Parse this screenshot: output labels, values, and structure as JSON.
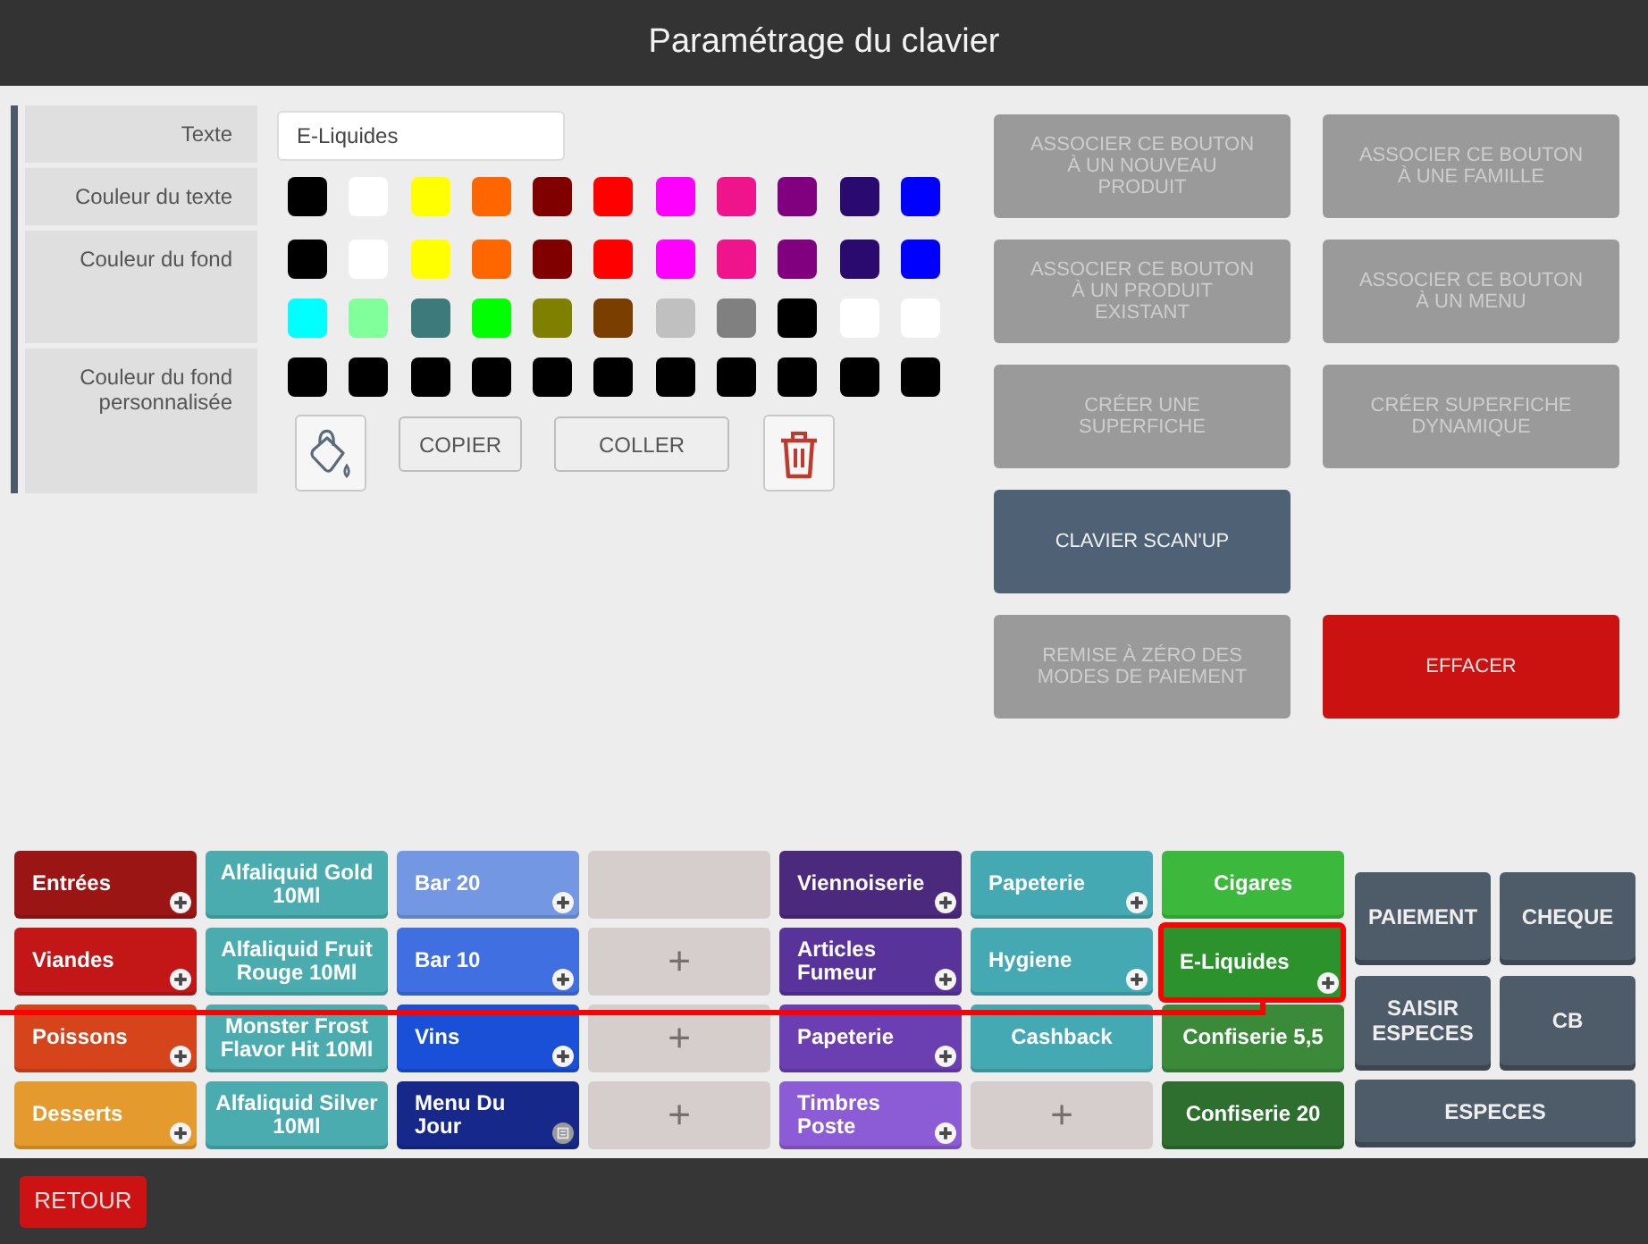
{
  "window": {
    "title": "Paramétrage du clavier"
  },
  "editor": {
    "text_field": {
      "label": "Texte",
      "value": "E-Liquides"
    },
    "text_color": {
      "label": "Couleur du texte",
      "swatches": [
        {
          "color": "#000000"
        },
        {
          "color": "#ffffff"
        },
        {
          "color": "#ffff00"
        },
        {
          "color": "#ff6600"
        },
        {
          "color": "#800000"
        },
        {
          "color": "#ff0000"
        },
        {
          "color": "#ff00ff"
        },
        {
          "color": "#f0148c"
        },
        {
          "color": "#800080"
        },
        {
          "color": "#2a0a6e"
        },
        {
          "color": "#0000ff"
        }
      ]
    },
    "background_color": {
      "label": "Couleur du fond",
      "swatches": [
        {
          "color": "#000000"
        },
        {
          "color": "#ffffff"
        },
        {
          "color": "#ffff00"
        },
        {
          "color": "#ff6600"
        },
        {
          "color": "#800000"
        },
        {
          "color": "#ff0000"
        },
        {
          "color": "#ff00ff"
        },
        {
          "color": "#f0148c"
        },
        {
          "color": "#800080"
        },
        {
          "color": "#2a0a6e"
        },
        {
          "color": "#0000ff"
        },
        {
          "color": "#00ffff"
        },
        {
          "color": "#80ff9a"
        },
        {
          "color": "#3d7a7a"
        },
        {
          "color": "#00ff00"
        },
        {
          "color": "#808000"
        },
        {
          "color": "#7a3e00"
        },
        {
          "color": "#c0c0c0"
        },
        {
          "color": "#808080"
        },
        {
          "color": "#000000"
        },
        {
          "color": "#ffffff"
        },
        {
          "color": "#ffffff"
        }
      ]
    },
    "custom_background": {
      "label": "Couleur du fond personnalisée",
      "swatches": [
        {
          "color": "#000000"
        },
        {
          "color": "#000000"
        },
        {
          "color": "#000000"
        },
        {
          "color": "#000000"
        },
        {
          "color": "#000000"
        },
        {
          "color": "#000000"
        },
        {
          "color": "#000000"
        },
        {
          "color": "#000000"
        },
        {
          "color": "#000000"
        },
        {
          "color": "#000000"
        },
        {
          "color": "#000000"
        }
      ],
      "tools": [
        {
          "kind": "fill"
        },
        {
          "kind": "copy",
          "label": "COPIER"
        },
        {
          "kind": "paste",
          "label": "COLLER"
        },
        {
          "kind": "delete"
        }
      ]
    }
  },
  "actions": [
    [
      {
        "label": "ASSOCIER CE BOUTON À UN NOUVEAU PRODUIT",
        "kind": "default",
        "disabled": true
      },
      {
        "label": "ASSOCIER CE BOUTON À UNE FAMILLE",
        "kind": "default",
        "disabled": true
      }
    ],
    [
      {
        "label": "ASSOCIER CE BOUTON À UN PRODUIT EXISTANT",
        "kind": "default",
        "disabled": true
      },
      {
        "label": "ASSOCIER CE BOUTON À UN MENU",
        "kind": "default",
        "disabled": true
      }
    ],
    [
      {
        "label": "CRÉER UNE SUPERFICHE",
        "kind": "default",
        "disabled": true
      },
      {
        "label": "CRÉER SUPERFICHE DYNAMIQUE",
        "kind": "default",
        "disabled": true
      }
    ],
    [
      {
        "label": "CLAVIER SCAN'UP",
        "kind": "keyboard",
        "disabled": false
      }
    ],
    [
      {
        "label": "REMISE À ZÉRO DES MODES DE PAIEMENT",
        "kind": "default",
        "disabled": true
      },
      {
        "label": "EFFACER",
        "kind": "danger",
        "disabled": false
      }
    ]
  ],
  "keys": [
    [
      {
        "label": "Entrées",
        "kind": "family",
        "color": "#9c1515",
        "highlighted": false
      },
      {
        "label": "Alfaliquid Gold 10Ml",
        "kind": "product",
        "color": "#4aacae",
        "highlighted": false
      },
      {
        "label": "Bar 20",
        "kind": "family",
        "color": "#7397e3",
        "highlighted": false
      },
      {
        "kind": "empty",
        "color": "#d5cecc",
        "highlighted": false
      },
      {
        "label": "Viennoiserie",
        "kind": "family",
        "color": "#4b2a7e",
        "highlighted": false
      },
      {
        "label": "Papeterie",
        "kind": "family",
        "color": "#45a9b3",
        "highlighted": false
      },
      {
        "label": "Cigares",
        "kind": "product",
        "color": "#3cb93c",
        "highlighted": false
      }
    ],
    [
      {
        "label": "Viandes",
        "kind": "family",
        "color": "#c31616",
        "highlighted": false
      },
      {
        "label": "Alfaliquid Fruit Rouge 10Ml",
        "kind": "product",
        "color": "#4aacae",
        "highlighted": false
      },
      {
        "label": "Bar 10",
        "kind": "family",
        "color": "#3f6fe0",
        "highlighted": false
      },
      {
        "label": "+",
        "kind": "empty",
        "color": "#d5cecc",
        "highlighted": false
      },
      {
        "label": "Articles Fumeur",
        "kind": "family",
        "color": "#57339a",
        "highlighted": false
      },
      {
        "label": "Hygiene",
        "kind": "family",
        "color": "#45a9b3",
        "highlighted": false
      },
      {
        "label": "E-Liquides",
        "kind": "family",
        "color": "#2c932c",
        "highlighted": true
      }
    ],
    [
      {
        "label": "Poissons",
        "kind": "family",
        "color": "#d6441c",
        "highlighted": false
      },
      {
        "label": "Monster Frost Flavor Hit 10Ml",
        "kind": "product",
        "color": "#4aacae",
        "highlighted": false
      },
      {
        "label": "Vins",
        "kind": "family",
        "color": "#1a4fd8",
        "highlighted": false
      },
      {
        "label": "+",
        "kind": "empty",
        "color": "#d5cecc",
        "highlighted": false
      },
      {
        "label": "Papeterie",
        "kind": "family",
        "color": "#6b3eb2",
        "highlighted": false
      },
      {
        "label": "Cashback",
        "kind": "product",
        "color": "#45a9b3",
        "highlighted": false
      },
      {
        "label": "Confiserie 5,5",
        "kind": "product",
        "color": "#3a8a3a",
        "highlighted": false
      }
    ],
    [
      {
        "label": "Desserts",
        "kind": "family",
        "color": "#e49a2c",
        "highlighted": false
      },
      {
        "label": "Alfaliquid Silver 10Ml",
        "kind": "product",
        "color": "#4aacae",
        "highlighted": false
      },
      {
        "label": "Menu Du Jour",
        "kind": "menu",
        "color": "#16298a",
        "highlighted": false
      },
      {
        "label": "+",
        "kind": "empty",
        "color": "#d5cecc",
        "highlighted": false
      },
      {
        "label": "Timbres Poste",
        "kind": "family",
        "color": "#8c5bd6",
        "highlighted": false
      },
      {
        "label": "+",
        "kind": "empty",
        "color": "#d5cecc",
        "highlighted": false
      },
      {
        "label": "Confiserie 20",
        "kind": "product",
        "color": "#2e6e2e",
        "highlighted": false
      }
    ]
  ],
  "payment": [
    [
      {
        "label": "PAIEMENT"
      },
      {
        "label": "CHEQUE"
      }
    ],
    [
      {
        "label": "SAISIR ESPECES"
      },
      {
        "label": "CB"
      }
    ],
    [
      {
        "label": "ESPECES"
      }
    ]
  ],
  "footer": {
    "back_button": "RETOUR"
  }
}
